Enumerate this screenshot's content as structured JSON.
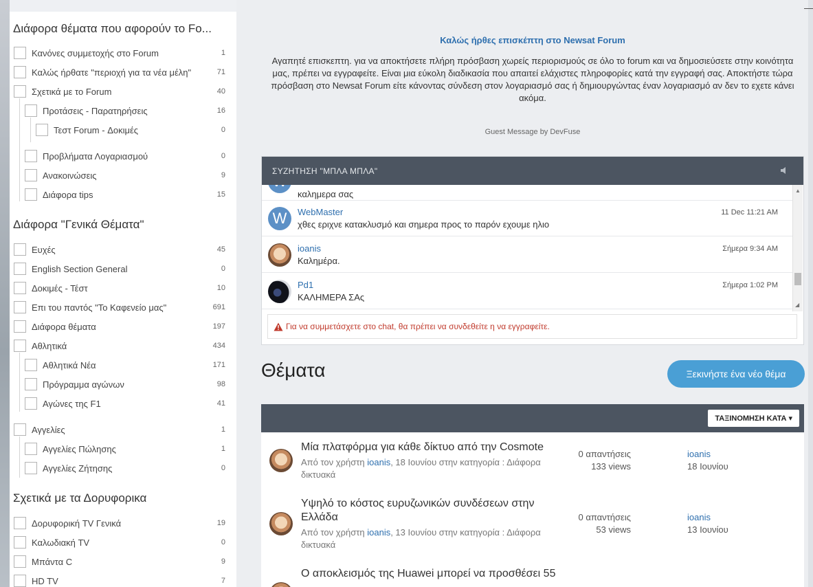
{
  "sidebar": {
    "sections": [
      {
        "title": "Διάφορα θέματα που αφορούν το Fo...",
        "items": [
          {
            "label": "Κανόνες συμμετοχής στο Forum",
            "count": "1"
          },
          {
            "label": "Καλώς ήρθατε \"περιοχή για τα νέα μέλη\"",
            "count": "71"
          },
          {
            "label": "Σχετικά με το Forum",
            "count": "40"
          },
          {
            "label": "Προτάσεις - Παρατηρήσεις",
            "count": "16"
          },
          {
            "label": "Τεστ Forum - Δοκιμές",
            "count": "0"
          },
          {
            "label": "Προβλήματα Λογαριασμού",
            "count": "0"
          },
          {
            "label": "Ανακοινώσεις",
            "count": "9"
          },
          {
            "label": "Διάφορα tips",
            "count": "15"
          }
        ]
      },
      {
        "title": "Διάφορα \"Γενικά Θέματα\"",
        "items": [
          {
            "label": "Ευχές",
            "count": "45"
          },
          {
            "label": "English Section General",
            "count": "0"
          },
          {
            "label": "Δοκιμές - Τέστ",
            "count": "10"
          },
          {
            "label": "Επι του παντός \"Το Καφενείο μας\"",
            "count": "691"
          },
          {
            "label": "Διάφορα θέματα",
            "count": "197"
          },
          {
            "label": "Αθλητικά",
            "count": "434"
          },
          {
            "label": "Αθλητικά Νέα",
            "count": "171"
          },
          {
            "label": "Πρόγραμμα αγώνων",
            "count": "98"
          },
          {
            "label": "Αγώνες της F1",
            "count": "41"
          },
          {
            "label": "Αγγελίες",
            "count": "1"
          },
          {
            "label": "Αγγελίες Πώλησης",
            "count": "1"
          },
          {
            "label": "Αγγελίες Ζήτησης",
            "count": "0"
          }
        ]
      },
      {
        "title": "Σχετικά με τα Δορυφορικα",
        "items": [
          {
            "label": "Δορυφορική TV Γενικά",
            "count": "19"
          },
          {
            "label": "Καλωδιακή TV",
            "count": "0"
          },
          {
            "label": "Μπάντα C",
            "count": "9"
          },
          {
            "label": "HD TV",
            "count": "7"
          }
        ]
      }
    ]
  },
  "welcome": {
    "title": "Καλώς ήρθες επισκέπτη στο Newsat Forum",
    "body": "Αγαπητέ επισκεπτη. για να αποκτήσετε πλήρη πρόσβαση χωρείς περιορισμούς σε όλο το forum και να δημοσιεύσετε στην κοινότητα μας, πρέπει να εγγραφείτε. Είναι μια εύκολη διαδικασία που απαιτεί ελάχιστες πληροφορίες κατά την εγγραφή σας. Αποκτήστε τώρα πρόσβαση στο  Newsat Forum είτε κάνοντας σύνδεση στον λογαριασμό σας ή δημιουργώντας έναν λογαριασμό αν δεν το εχετε κάνει ακόμα.",
    "credit": "Guest Message by DevFuse"
  },
  "chat": {
    "title": "ΣΥΖΗΤΗΣΗ \"ΜΠΛΑ ΜΠΛΑ\"",
    "messages": [
      {
        "user": "",
        "text": "καλημερα σας",
        "time": "",
        "avatar": "W"
      },
      {
        "user": "WebMaster",
        "text": "χθες εριχνε κατακλυσμό και σημερα προς το παρόν εχουμε ηλιο",
        "time": "11 Dec 11:21 AM",
        "avatar": "W"
      },
      {
        "user": "ioanis",
        "text": "Καλημέρα.",
        "time": "Σήμερα 9:34 AM",
        "avatar": "photo"
      },
      {
        "user": "Pd1",
        "text": "ΚΑΛΗΜΕΡΑ ΣΑς",
        "time": "Σήμερα 1:02 PM",
        "avatar": "dark"
      }
    ],
    "notice": "Για να συμμετάσχετε στο chat, θα πρέπει να συνδεθείτε η να εγγραφείτε."
  },
  "topics": {
    "heading": "Θέματα",
    "new_topic_label": "Ξεκινήστε ένα νέο θέμα",
    "sort_label": "ΤΑΞΙΝΟΜΗΣΗ ΚΑΤΑ ▾",
    "items": [
      {
        "title": "Μία πλατφόρμα για κάθε δίκτυο από την Cosmote",
        "meta_prefix": "Από τον χρήστη ",
        "author": "ioanis",
        "meta_suffix": ", 18 Ιουνίου στην κατηγορία : Διάφορα δικτυακά",
        "replies": "0 απαντήσεις",
        "views": "133 views",
        "last_user": "ioanis",
        "last_date": "18 Ιουνίου"
      },
      {
        "title": "Υψηλό το κόστος ευρυζωνικών συνδέσεων στην Ελλάδα",
        "meta_prefix": "Από τον χρήστη ",
        "author": "ioanis",
        "meta_suffix": ", 13 Ιουνίου στην κατηγορία : Διάφορα δικτυακά",
        "replies": "0 απαντήσεις",
        "views": "53 views",
        "last_user": "ioanis",
        "last_date": "13 Ιουνίου"
      },
      {
        "title": "Ο αποκλεισμός της Huawei μπορεί να προσθέσει 55",
        "meta_prefix": "",
        "author": "",
        "meta_suffix": "",
        "replies": "",
        "views": "",
        "last_user": "",
        "last_date": ""
      }
    ]
  },
  "colors": {
    "accent": "#2e6fae",
    "header_bar": "#4c5561",
    "button": "#4a9fd5",
    "error": "#c0392b"
  }
}
